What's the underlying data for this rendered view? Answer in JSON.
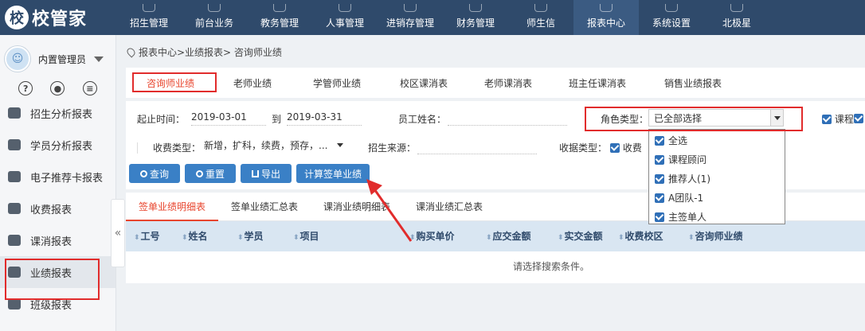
{
  "app": {
    "logo_text": "校管家",
    "logo_mark": "校"
  },
  "nav": [
    {
      "label": "招生管理"
    },
    {
      "label": "前台业务"
    },
    {
      "label": "教务管理"
    },
    {
      "label": "人事管理"
    },
    {
      "label": "进销存管理"
    },
    {
      "label": "财务管理"
    },
    {
      "label": "师生信"
    },
    {
      "label": "报表中心"
    },
    {
      "label": "系统设置"
    },
    {
      "label": "北极星"
    }
  ],
  "nav_active": "报表中心",
  "user": {
    "name": "内置管理员",
    "icons": [
      "help-icon",
      "bell-icon",
      "message-icon"
    ]
  },
  "sidebar": {
    "items": [
      {
        "label": "招生分析报表"
      },
      {
        "label": "学员分析报表"
      },
      {
        "label": "电子推荐卡报表"
      },
      {
        "label": "收费报表"
      },
      {
        "label": "课消报表"
      },
      {
        "label": "业绩报表"
      },
      {
        "label": "班级报表"
      }
    ],
    "active": "业绩报表",
    "collapse_glyph": "«"
  },
  "breadcrumb": "报表中心>业绩报表> 咨询师业绩",
  "subtabs": [
    "咨询师业绩",
    "老师业绩",
    "学管师业绩",
    "校区课消表",
    "老师课消表",
    "班主任课消表",
    "销售业绩报表"
  ],
  "subtab_active": "咨询师业绩",
  "filters": {
    "start_label": "起止时间：",
    "start_value": "2019-03-01",
    "to_label": "到",
    "end_value": "2019-03-31",
    "staff_label": "员工姓名：",
    "staff_value": "",
    "role_label": "角色类型：",
    "role_value": "已全部选择",
    "course_label": "课程",
    "fee_type_label": "收费类型：",
    "fee_type_value": "新增，扩科，续费，预存，...",
    "source_label": "招生来源：",
    "source_value": "",
    "receipt_label": "收据类型：",
    "receipt_value": "收费"
  },
  "buttons": {
    "query": "查询",
    "reset": "重置",
    "export": "导出",
    "calc": "计算签单业绩"
  },
  "role_options": [
    "全选",
    "课程顾问",
    "推荐人(1)",
    "A团队-1",
    "主签单人"
  ],
  "table_tabs": [
    "签单业绩明细表",
    "签单业绩汇总表",
    "课消业绩明细表",
    "课消业绩汇总表"
  ],
  "table_tab_active": "签单业绩明细表",
  "columns": [
    "工号",
    "姓名",
    "学员",
    "项目",
    "购买单价",
    "应交金额",
    "实交金额",
    "收费校区",
    "咨询师业绩"
  ],
  "empty_text": "请选择搜索条件。",
  "colors": {
    "nav_bg": "#2f4a6b",
    "accent": "#3a80c6",
    "highlight": "#e12c2c",
    "active_tab": "#e8452e",
    "table_head": "#d9e6f2"
  }
}
